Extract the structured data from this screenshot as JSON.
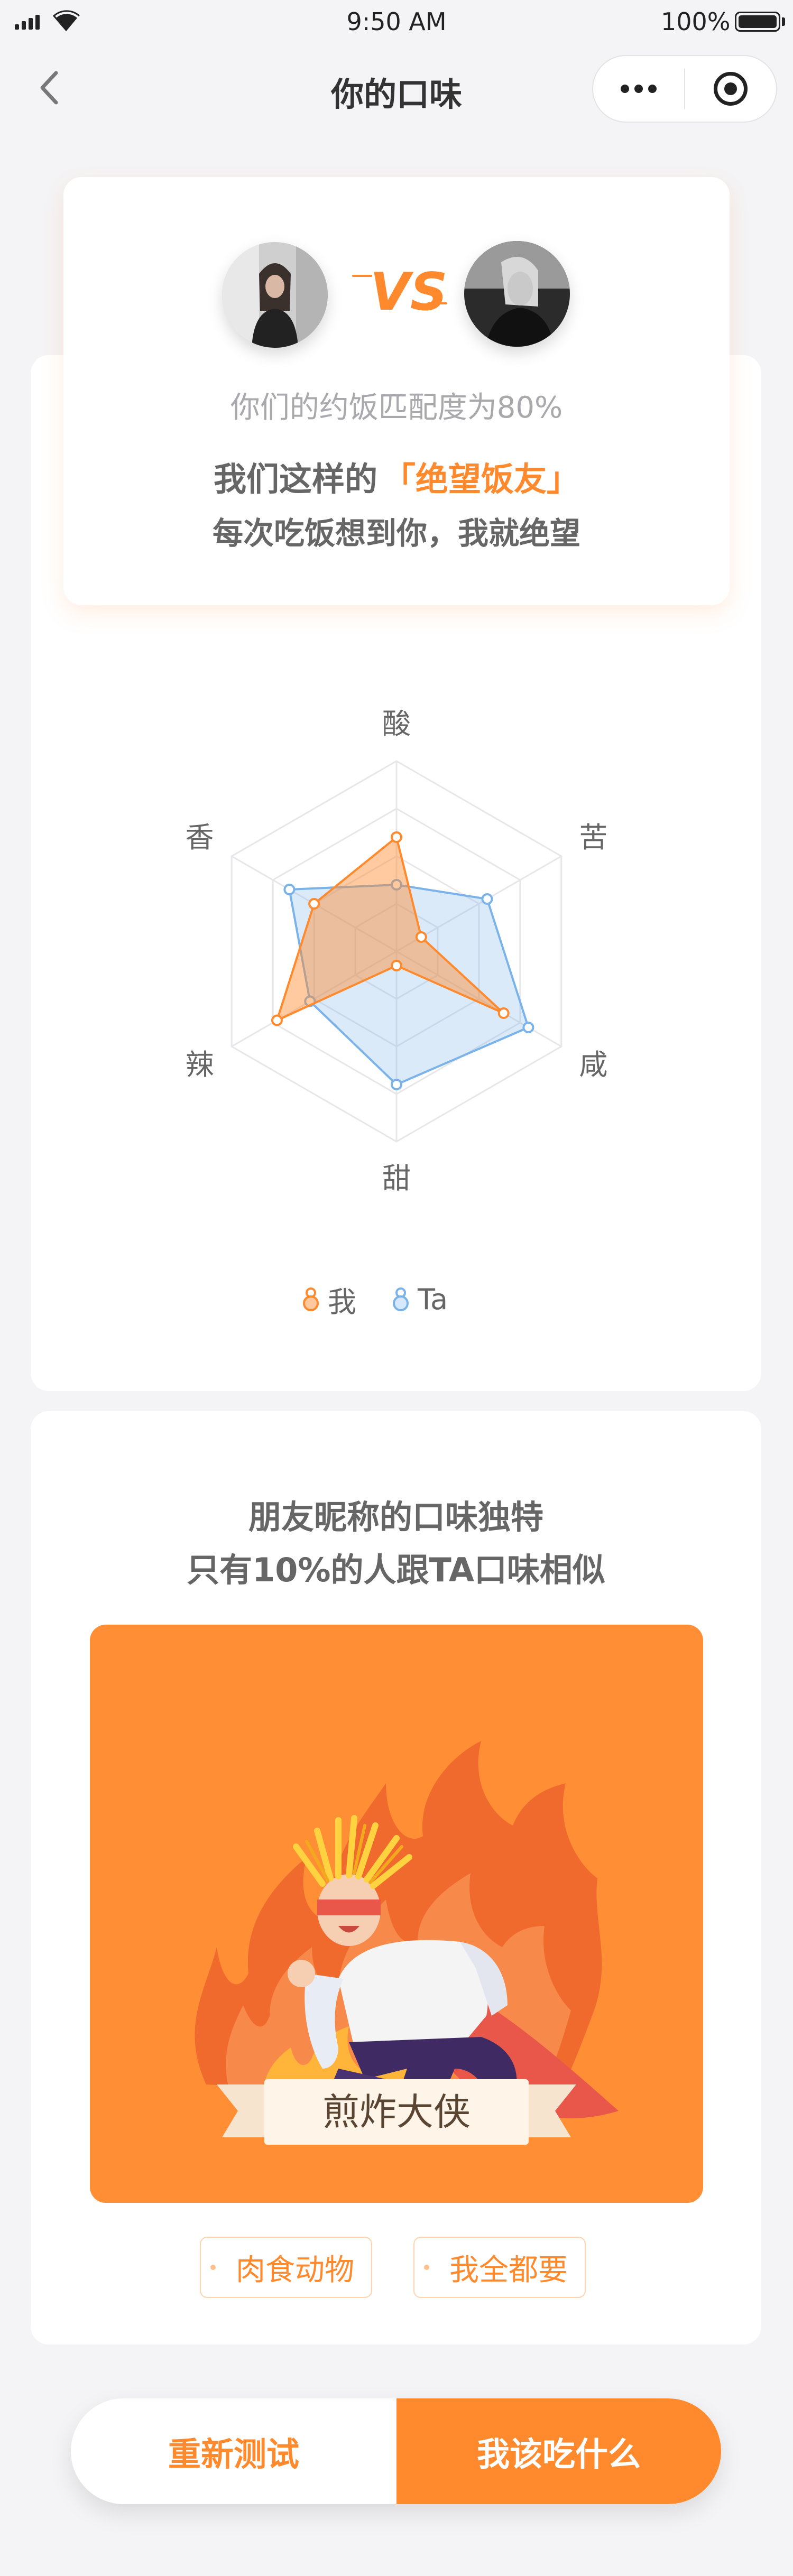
{
  "status_bar": {
    "time": "9:50 AM",
    "battery": "100%"
  },
  "nav": {
    "title": "你的口味",
    "back_icon": "chevron-left-icon",
    "more_icon": "more-dots-icon",
    "close_icon": "target-icon"
  },
  "match": {
    "line1": "你们的约饭匹配度为80%",
    "line2_prefix": "我们这样的",
    "line2_highlight": "「绝望饭友」",
    "line3": "每次吃饭想到你，我就绝望",
    "vs_label": "VS"
  },
  "chart_data": {
    "type": "radar",
    "axes": [
      "酸",
      "苦",
      "咸",
      "甜",
      "辣",
      "香"
    ],
    "max": 4,
    "grid_levels": 4,
    "series": [
      {
        "name": "我",
        "color": "#ff8a2d",
        "values": [
          2.4,
          0.6,
          2.6,
          0.3,
          2.9,
          2.0
        ]
      },
      {
        "name": "Ta",
        "color": "#7ab2ea",
        "values": [
          1.4,
          2.2,
          3.2,
          2.8,
          2.1,
          2.6
        ]
      }
    ]
  },
  "legend": [
    {
      "label": "我",
      "color": "#ff8a2d"
    },
    {
      "label": "Ta",
      "color": "#7ab2ea"
    }
  ],
  "unique": {
    "line1": "朋友昵称的口味独特",
    "line2": "只有10%的人跟TA口味相似",
    "hero_banner": "煎炸大侠"
  },
  "tags": [
    "肉食动物",
    "我全都要"
  ],
  "actions": {
    "retest": "重新测试",
    "what_to_eat": "我该吃什么"
  },
  "colors": {
    "accent": "#ff8a2d",
    "ta_blue": "#7ab2ea",
    "background": "#f4f4f6"
  }
}
